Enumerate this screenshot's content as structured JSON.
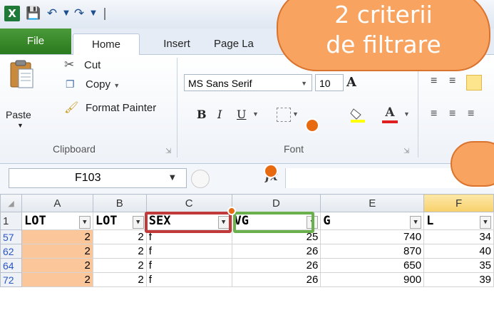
{
  "titlebar": {
    "qat_separator": "|",
    "excel_icon_letter": "X",
    "icons": [
      "excel-logo-icon",
      "save-icon",
      "undo-icon",
      "dropdown-arrow-icon",
      "redo-icon",
      "dropdown-arrow-icon",
      "customize-qat-icon"
    ]
  },
  "tabs": [
    {
      "label": "File"
    },
    {
      "label": "Home"
    },
    {
      "label": "Insert"
    },
    {
      "label": "Page La"
    }
  ],
  "ribbon": {
    "clipboard": {
      "paste_label": "Paste",
      "cut_label": "Cut",
      "copy_label": "Copy",
      "format_painter_label": "Format Painter",
      "group_label": "Clipboard"
    },
    "font": {
      "font_name": "MS Sans Serif",
      "font_size": "10",
      "bold": "B",
      "italic": "I",
      "underline": "U",
      "font_color_glyph": "A",
      "grow_glyph": "A",
      "group_label": "Font"
    }
  },
  "formula_bar": {
    "name_box": "F103",
    "fx": "fx"
  },
  "grid": {
    "columns": [
      "A",
      "B",
      "C",
      "D",
      "E",
      "F"
    ],
    "header_row": {
      "row": "1",
      "cells": [
        "LOT",
        "LOT",
        "SEX",
        "VG",
        "G",
        "L"
      ]
    },
    "rows": [
      {
        "row": "57",
        "cells": [
          "2",
          "2",
          "f",
          "25",
          "740",
          "34"
        ]
      },
      {
        "row": "62",
        "cells": [
          "2",
          "2",
          "f",
          "26",
          "870",
          "40"
        ]
      },
      {
        "row": "64",
        "cells": [
          "2",
          "2",
          "f",
          "26",
          "650",
          "35"
        ]
      },
      {
        "row": "72",
        "cells": [
          "2",
          "2",
          "f",
          "26",
          "900",
          "39"
        ]
      }
    ]
  },
  "callout": {
    "line1": "2 criterii",
    "line2": "de filtrare"
  },
  "colors": {
    "callout_fill": "#f8a360",
    "sex_filter_highlight": "#c0393b",
    "vg_filter_highlight": "#6ab04c",
    "file_tab": "#2a7a1e",
    "row_number": "#2a56c6",
    "lot_column_fill": "#fbc69a"
  }
}
